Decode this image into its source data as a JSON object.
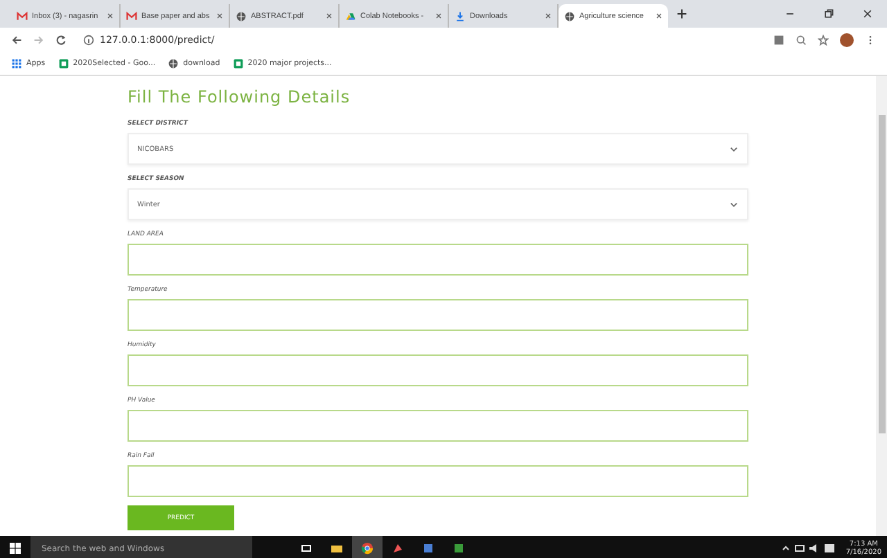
{
  "tabs": [
    {
      "label": "Inbox (3) - nagasrin",
      "selected": false
    },
    {
      "label": "Base paper and abs",
      "selected": false
    },
    {
      "label": "ABSTRACT.pdf",
      "selected": false
    },
    {
      "label": "Colab Notebooks -",
      "selected": false
    },
    {
      "label": "Downloads",
      "selected": false
    },
    {
      "label": "Agriculture science",
      "selected": true
    }
  ],
  "address": "127.0.0.1:8000/predict/",
  "bookmarks": [
    {
      "label": "Apps"
    },
    {
      "label": "2020Selected - Goo..."
    },
    {
      "label": "download"
    },
    {
      "label": "2020 major projects..."
    }
  ],
  "form": {
    "title": "Fill The Following Details",
    "fields": [
      {
        "kind": "select",
        "label": "SELECT DISTRICT",
        "value": "NICOBARS"
      },
      {
        "kind": "select",
        "label": "SELECT SEASON",
        "value": "Winter"
      },
      {
        "kind": "input",
        "label": "LAND AREA"
      },
      {
        "kind": "input",
        "label": "Temperature"
      },
      {
        "kind": "input",
        "label": "Humidity"
      },
      {
        "kind": "input",
        "label": "PH Value"
      },
      {
        "kind": "input",
        "label": "Rain Fall"
      }
    ],
    "submit": "PREDICT"
  },
  "taskbar": {
    "search": "Search the web and Windows",
    "time": "7:13 AM",
    "date": "7/16/2020"
  }
}
